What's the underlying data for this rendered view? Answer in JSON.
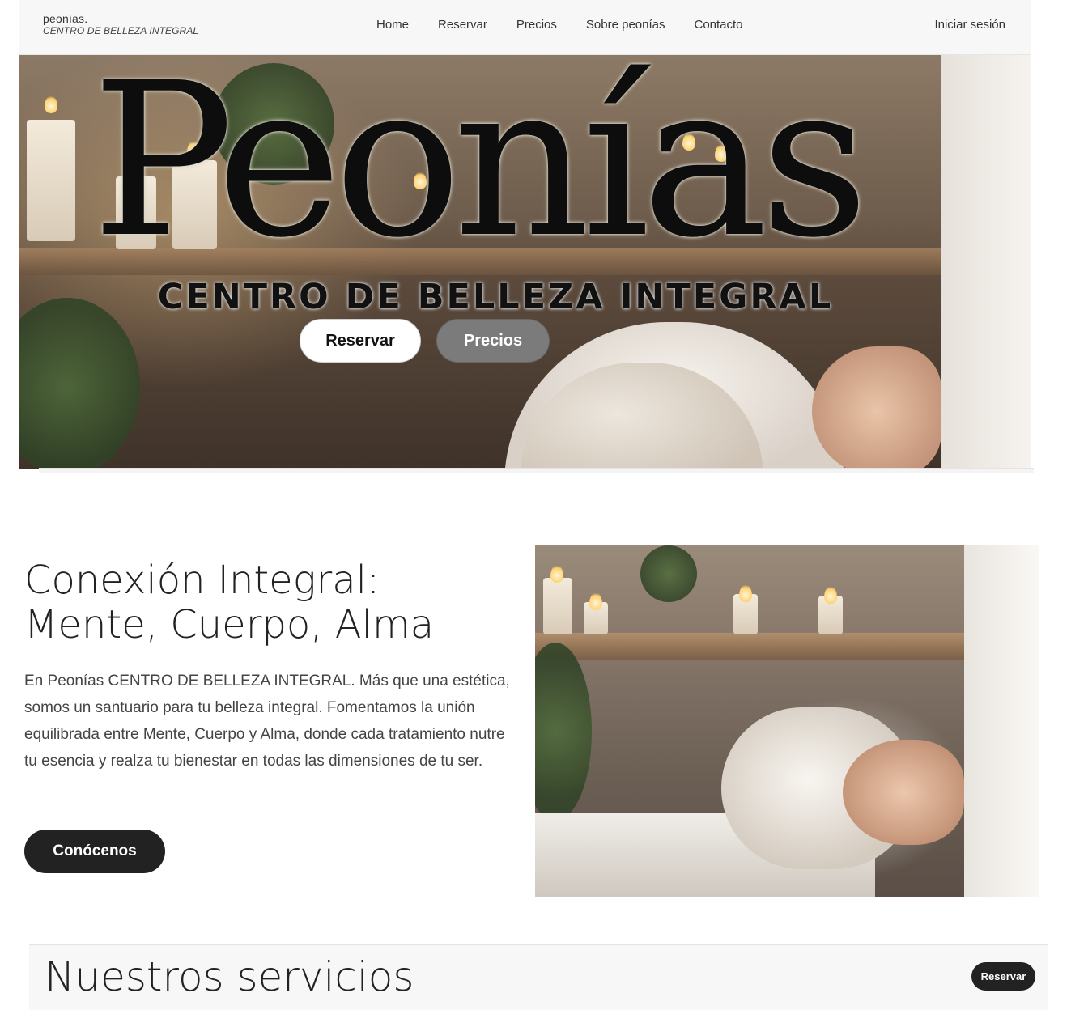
{
  "header": {
    "brand_name": "peonías.",
    "brand_sub": "CENTRO DE BELLEZA INTEGRAL",
    "nav": [
      "Home",
      "Reservar",
      "Precios",
      "Sobre peonías",
      "Contacto"
    ],
    "login": "Iniciar sesión"
  },
  "hero": {
    "title": "Peonías",
    "subtitle": "CENTRO DE BELLEZA INTEGRAL",
    "reserve_label": "Reservar",
    "prices_label": "Precios"
  },
  "about": {
    "title": "Conexión Integral: Mente, Cuerpo, Alma",
    "text": "En Peonías CENTRO DE BELLEZA INTEGRAL. Más que una estética, somos un santuario para tu belleza integral. Fomentamos la unión equilibrada entre Mente, Cuerpo y Alma, donde cada tratamiento nutre tu esencia y realza tu bienestar en todas las dimensiones de tu ser.",
    "button_label": "Conócenos"
  },
  "services": {
    "title": "Nuestros servicios",
    "button_label": "Reservar"
  },
  "colors": {
    "dark_button": "#222222",
    "gray_button": "#7b7b7b",
    "header_bg": "#f7f7f7"
  }
}
